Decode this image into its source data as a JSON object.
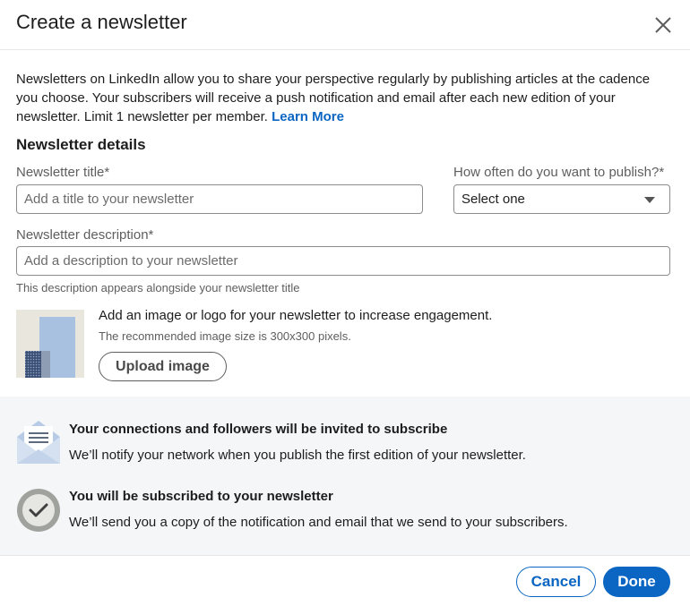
{
  "dialog": {
    "title": "Create a newsletter",
    "close_label": "Close"
  },
  "intro": {
    "text": "Newsletters on LinkedIn allow you to share your perspective regularly by publishing articles at the cadence you choose. Your subscribers will receive a push notification and email after each new edition of your newsletter. Limit 1 newsletter per member.",
    "learn_more": "Learn More"
  },
  "details": {
    "heading": "Newsletter details",
    "title_label": "Newsletter title*",
    "title_placeholder": "Add a title to your newsletter",
    "frequency_label": "How often do you want to publish?*",
    "frequency_value": "Select one",
    "description_label": "Newsletter description*",
    "description_placeholder": "Add a description to your newsletter",
    "description_helper": "This description appears alongside your newsletter title"
  },
  "image": {
    "title": "Add an image or logo for your newsletter to increase engagement.",
    "subtitle": "The recommended image size is 300x300 pixels.",
    "upload_label": "Upload image"
  },
  "info": {
    "invite_title": "Your connections and followers will be invited to subscribe",
    "invite_text": "We’ll notify your network when you publish the first edition of your newsletter.",
    "subscribe_title": "You will be subscribed to your newsletter",
    "subscribe_text": "We’ll send you a copy of the notification and email that we send to your subscribers."
  },
  "footer": {
    "cancel_label": "Cancel",
    "done_label": "Done"
  },
  "colors": {
    "accent": "#0a66c2",
    "section_background": "#f4f6f8"
  }
}
